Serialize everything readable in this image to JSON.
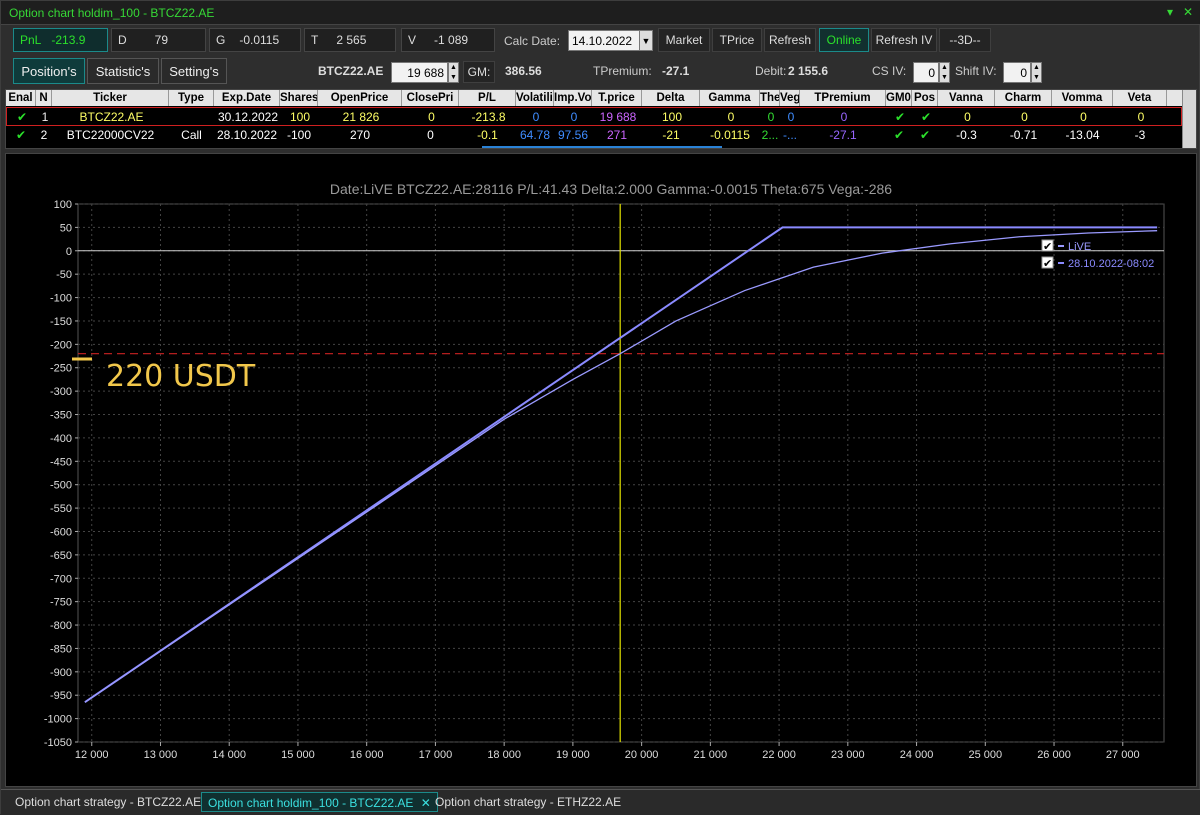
{
  "window": {
    "title": "Option chart holdim_100 - BTCZ22.AE",
    "dropdown_glyph": "▾",
    "close_glyph": "✕"
  },
  "metrics": [
    {
      "label": "PnL",
      "value": "-213.9"
    },
    {
      "label": "D",
      "value": "79"
    },
    {
      "label": "G",
      "value": "-0.0115"
    },
    {
      "label": "T",
      "value": "2 565"
    },
    {
      "label": "V",
      "value": "-1 089"
    }
  ],
  "calc_date": {
    "label": "Calc Date:",
    "value": "14.10.2022"
  },
  "buttons": {
    "market": "Market",
    "tprice": "TPrice",
    "refresh": "Refresh",
    "online": "Online",
    "refresh_iv": "Refresh IV",
    "threed": "--3D--"
  },
  "tabs": [
    {
      "label": "Position's"
    },
    {
      "label": "Statistic's"
    },
    {
      "label": "Setting's"
    }
  ],
  "toolbar2": {
    "ticker": "BTCZ22.AE",
    "price": "19 688",
    "gm_label": "GM:",
    "gm_value": "386.56",
    "tpremium_label": "TPremium:",
    "tpremium_value": "-27.1",
    "debit_label": "Debit:",
    "debit_value": "2 155.6",
    "cs_iv_label": "CS IV:",
    "cs_iv_value": "0",
    "shift_iv_label": "Shift IV:",
    "shift_iv_value": "0"
  },
  "grid": {
    "columns": [
      "Enal",
      "N",
      "Ticker",
      "Type",
      "Exp.Date",
      "Shares",
      "OpenPrice",
      "ClosePri",
      "P/L",
      "Volatilit",
      "Imp.Vo",
      "T.price",
      "Delta",
      "Gamma",
      "The",
      "Veg",
      "TPremium",
      "GM0",
      "Pos",
      "Vanna",
      "Charm",
      "Vomma",
      "Veta"
    ],
    "rows": [
      {
        "n": "1",
        "ticker": "BTCZ22.AE",
        "type": "",
        "exp": "30.12.2022",
        "shares": "100",
        "open": "21 826",
        "close": "0",
        "pl": "-213.8",
        "vol": "0",
        "impvol": "0",
        "tprice": "19 688",
        "delta": "100",
        "gamma": "0",
        "theta": "0",
        "vega": "0",
        "tpremium": "0",
        "vanna": "0",
        "charm": "0",
        "vomma": "0",
        "veta": "0"
      },
      {
        "n": "2",
        "ticker": "BTC22000CV22",
        "type": "Call",
        "exp": "28.10.2022",
        "shares": "-100",
        "open": "270",
        "close": "0",
        "pl": "-0.1",
        "vol": "64.78",
        "impvol": "97.56",
        "tprice": "271",
        "delta": "-21",
        "gamma": "-0.0115",
        "theta": "2...",
        "vega": "-...",
        "tpremium": "-27.1",
        "vanna": "-0.3",
        "charm": "-0.71",
        "vomma": "-13.04",
        "veta": "-3"
      }
    ]
  },
  "chart": {
    "header": "Date:LiVE  BTCZ22.AE:28116  P/L:41.43  Delta:2.000  Gamma:-0.0015  Theta:675  Vega:-286",
    "annotation": "220 USDT",
    "legend": [
      "LiVE",
      "28.10.2022-08:02"
    ],
    "line_color_expiry": "#8a8aff",
    "line_color_live": "#9a9aff",
    "hline_color": "#cc2222",
    "vline_color": "#e6e600"
  },
  "chart_data": {
    "type": "line",
    "xlim": [
      11800,
      27600
    ],
    "ylim": [
      -1050,
      100
    ],
    "xticks": [
      12000,
      13000,
      14000,
      15000,
      16000,
      17000,
      18000,
      19000,
      20000,
      21000,
      22000,
      23000,
      24000,
      25000,
      26000,
      27000
    ],
    "xtick_labels": [
      "12 000",
      "13 000",
      "14 000",
      "15 000",
      "16 000",
      "17 000",
      "18 000",
      "19 000",
      "20 000",
      "21 000",
      "22 000",
      "23 000",
      "24 000",
      "25 000",
      "26 000",
      "27 000"
    ],
    "yticks": [
      100,
      50,
      0,
      -50,
      -100,
      -150,
      -200,
      -250,
      -300,
      -350,
      -400,
      -450,
      -500,
      -550,
      -600,
      -650,
      -700,
      -750,
      -800,
      -850,
      -900,
      -950,
      -1000,
      -1050
    ],
    "grid": true,
    "legend_position": "top-right",
    "current_price": 19688,
    "breakeven_line": -220,
    "series": [
      {
        "name": "28.10.2022-08:02",
        "x": [
          11900,
          22050,
          27500
        ],
        "y": [
          -965,
          50,
          50
        ]
      },
      {
        "name": "LiVE",
        "x": [
          11900,
          18000,
          19000,
          19688,
          20500,
          21500,
          22500,
          23500,
          24500,
          25500,
          26500,
          27500
        ],
        "y": [
          -965,
          -360,
          -275,
          -220,
          -150,
          -85,
          -35,
          -5,
          15,
          30,
          38,
          43
        ]
      }
    ]
  },
  "bottom_tabs": [
    {
      "label": "Option chart strategy - BTCZ22.AE"
    },
    {
      "label": "Option chart holdim_100 - BTCZ22.AE"
    },
    {
      "label": "Option chart strategy - ETHZ22.AE"
    }
  ]
}
